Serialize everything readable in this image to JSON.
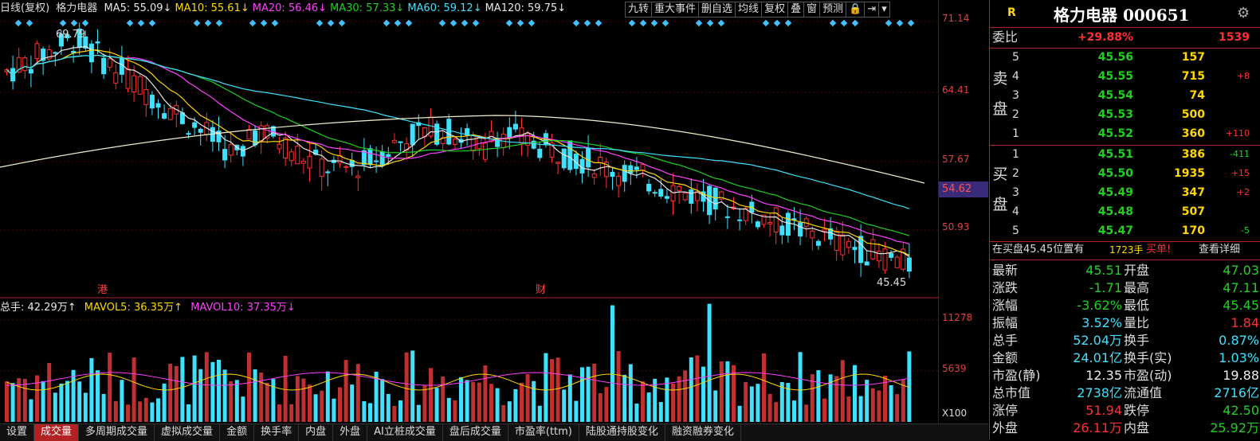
{
  "header": {
    "title": "日线(复权)",
    "stock": "格力电器",
    "ma": [
      {
        "label": "MA5: 55.09↓",
        "color": "#e8e8e8"
      },
      {
        "label": "MA10: 55.61↓",
        "color": "#ffd800"
      },
      {
        "label": "MA20: 56.46↓",
        "color": "#ff40ff"
      },
      {
        "label": "MA30: 57.33↓",
        "color": "#20d020"
      },
      {
        "label": "MA60: 59.12↓",
        "color": "#40e0ff"
      },
      {
        "label": "MA120: 59.75↓",
        "color": "#e8e8e8"
      }
    ]
  },
  "toolbar": [
    "九转",
    "重大事件",
    "删自选",
    "均线",
    "复权",
    "叠",
    "窗",
    "预测",
    "🔒",
    "⇥",
    "▾"
  ],
  "price_axis": [
    "71.14",
    "64.41",
    "57.67",
    "54.62",
    "50.93"
  ],
  "current_price_box": "54.62",
  "annotations": {
    "high": "69.79",
    "low": "45.45",
    "gang": "港",
    "cai": "财"
  },
  "volume_header": {
    "zs": "总手: 42.29万↑",
    "mavol5": "MAVOL5: 36.35万↑",
    "mavol10": "MAVOL10: 37.35万↓"
  },
  "volume_axis": [
    "11278",
    "5639",
    "X100"
  ],
  "tabs": [
    "设置",
    "成交量",
    "多周期成交量",
    "虚拟成交量",
    "金额",
    "换手率",
    "内盘",
    "外盘",
    "AI立桩成交量",
    "盘后成交量",
    "市盈率(ttm)",
    "陆股通持股变化",
    "融资融券变化"
  ],
  "quote": {
    "r": "R",
    "title": "格力电器 000651",
    "weibi_label": "委比",
    "weibi_value": "+29.88%",
    "weibi_vol": "1539",
    "sell_label": "卖盘",
    "buy_label": "买盘",
    "sell": [
      {
        "lvl": "5",
        "price": "45.56",
        "vol": "157",
        "chg": ""
      },
      {
        "lvl": "4",
        "price": "45.55",
        "vol": "715",
        "chg": "+8"
      },
      {
        "lvl": "3",
        "price": "45.54",
        "vol": "74",
        "chg": ""
      },
      {
        "lvl": "2",
        "price": "45.53",
        "vol": "500",
        "chg": ""
      },
      {
        "lvl": "1",
        "price": "45.52",
        "vol": "360",
        "chg": "+110"
      }
    ],
    "buy": [
      {
        "lvl": "1",
        "price": "45.51",
        "vol": "386",
        "chg": "-411"
      },
      {
        "lvl": "2",
        "price": "45.50",
        "vol": "1935",
        "chg": "+15"
      },
      {
        "lvl": "3",
        "price": "45.49",
        "vol": "347",
        "chg": "+2"
      },
      {
        "lvl": "4",
        "price": "45.48",
        "vol": "507",
        "chg": ""
      },
      {
        "lvl": "5",
        "price": "45.47",
        "vol": "170",
        "chg": "-5"
      }
    ],
    "notice_a": "在买盘45.45位置有",
    "notice_b": "1723手",
    "notice_c": "买单!",
    "notice_d": "查看详细",
    "stats": [
      {
        "l1": "最新",
        "v1": "45.51",
        "c1": "green",
        "l2": "开盘",
        "v2": "47.03",
        "c2": "green"
      },
      {
        "l1": "涨跌",
        "v1": "-1.71",
        "c1": "green",
        "l2": "最高",
        "v2": "47.11",
        "c2": "green"
      },
      {
        "l1": "涨幅",
        "v1": "-3.62%",
        "c1": "green",
        "l2": "最低",
        "v2": "45.45",
        "c2": "green"
      },
      {
        "l1": "振幅",
        "v1": "3.52%",
        "c1": "cyan",
        "l2": "量比",
        "v2": "1.84",
        "c2": "red"
      },
      {
        "l1": "总手",
        "v1": "52.04万",
        "c1": "cyan",
        "l2": "换手",
        "v2": "0.87%",
        "c2": "cyan"
      },
      {
        "l1": "金额",
        "v1": "24.01亿",
        "c1": "cyan",
        "l2": "换手(实)",
        "v2": "1.03%",
        "c2": "cyan"
      },
      {
        "l1": "市盈(静)",
        "v1": "12.35",
        "c1": "white",
        "l2": "市盈(动)",
        "v2": "19.88",
        "c2": "white"
      },
      {
        "l1": "总市值",
        "v1": "2738亿",
        "c1": "cyan",
        "l2": "流通值",
        "v2": "2716亿",
        "c2": "cyan"
      },
      {
        "l1": "涨停",
        "v1": "51.94",
        "c1": "red",
        "l2": "跌停",
        "v2": "42.50",
        "c2": "green"
      },
      {
        "l1": "外盘",
        "v1": "26.11万",
        "c1": "red",
        "l2": "内盘",
        "v2": "25.92万",
        "c2": "green"
      }
    ]
  }
}
